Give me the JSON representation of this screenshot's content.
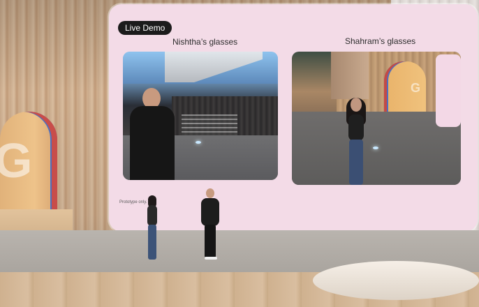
{
  "screen": {
    "badge_text": "Live Demo",
    "left_caption": "Nishtha’s glasses",
    "right_caption": "Shahram’s glasses",
    "footnote": "Prototype only."
  }
}
